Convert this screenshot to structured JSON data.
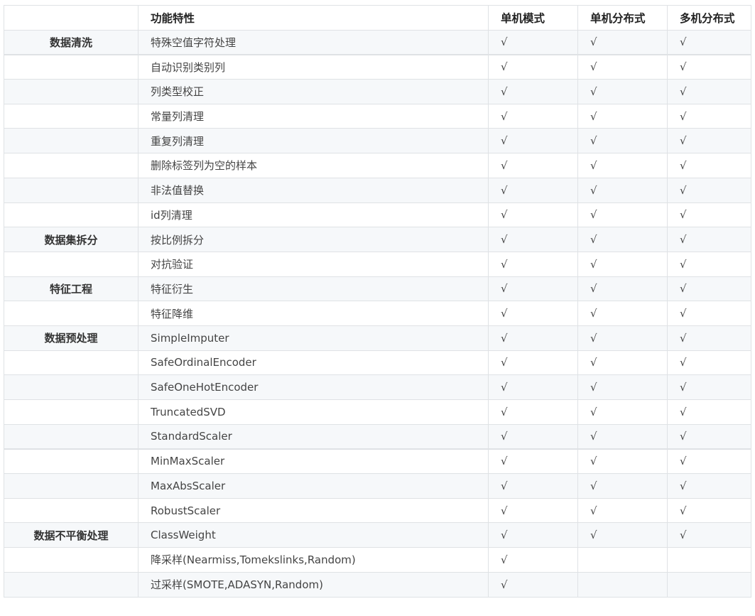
{
  "table": {
    "headers": [
      "",
      "功能特性",
      "单机模式",
      "单机分布式",
      "多机分布式"
    ],
    "check": "√",
    "rows": [
      {
        "category": "数据清洗",
        "feature": "特殊空值字符处理",
        "standalone": true,
        "standalone_distributed": true,
        "multi_distributed": true
      },
      {
        "category": "",
        "feature": "自动识别类别列",
        "standalone": true,
        "standalone_distributed": true,
        "multi_distributed": true
      },
      {
        "category": "",
        "feature": "列类型校正",
        "standalone": true,
        "standalone_distributed": true,
        "multi_distributed": true
      },
      {
        "category": "",
        "feature": "常量列清理",
        "standalone": true,
        "standalone_distributed": true,
        "multi_distributed": true
      },
      {
        "category": "",
        "feature": "重复列清理",
        "standalone": true,
        "standalone_distributed": true,
        "multi_distributed": true
      },
      {
        "category": "",
        "feature": "删除标签列为空的样本",
        "standalone": true,
        "standalone_distributed": true,
        "multi_distributed": true
      },
      {
        "category": "",
        "feature": "非法值替换",
        "standalone": true,
        "standalone_distributed": true,
        "multi_distributed": true
      },
      {
        "category": "",
        "feature": "id列清理",
        "standalone": true,
        "standalone_distributed": true,
        "multi_distributed": true
      },
      {
        "category": "数据集拆分",
        "feature": "按比例拆分",
        "standalone": true,
        "standalone_distributed": true,
        "multi_distributed": true
      },
      {
        "category": "",
        "feature": "对抗验证",
        "standalone": true,
        "standalone_distributed": true,
        "multi_distributed": true
      },
      {
        "category": "特征工程",
        "feature": "特征衍生",
        "standalone": true,
        "standalone_distributed": true,
        "multi_distributed": true
      },
      {
        "category": "",
        "feature": "特征降维",
        "standalone": true,
        "standalone_distributed": true,
        "multi_distributed": true
      },
      {
        "category": "数据预处理",
        "feature": "SimpleImputer",
        "standalone": true,
        "standalone_distributed": true,
        "multi_distributed": true
      },
      {
        "category": "",
        "feature": "SafeOrdinalEncoder",
        "standalone": true,
        "standalone_distributed": true,
        "multi_distributed": true
      },
      {
        "category": "",
        "feature": "SafeOneHotEncoder",
        "standalone": true,
        "standalone_distributed": true,
        "multi_distributed": true
      },
      {
        "category": "",
        "feature": "TruncatedSVD",
        "standalone": true,
        "standalone_distributed": true,
        "multi_distributed": true
      },
      {
        "category": "",
        "feature": "StandardScaler",
        "standalone": true,
        "standalone_distributed": true,
        "multi_distributed": true
      },
      {
        "category": "",
        "feature": "MinMaxScaler",
        "standalone": true,
        "standalone_distributed": true,
        "multi_distributed": true
      },
      {
        "category": "",
        "feature": "MaxAbsScaler",
        "standalone": true,
        "standalone_distributed": true,
        "multi_distributed": true
      },
      {
        "category": "",
        "feature": "RobustScaler",
        "standalone": true,
        "standalone_distributed": true,
        "multi_distributed": true
      },
      {
        "category": "数据不平衡处理",
        "feature": "ClassWeight",
        "standalone": true,
        "standalone_distributed": true,
        "multi_distributed": true
      },
      {
        "category": "",
        "feature": "降采样(Nearmiss,Tomekslinks,Random)",
        "standalone": true,
        "standalone_distributed": false,
        "multi_distributed": false
      },
      {
        "category": "",
        "feature": "过采样(SMOTE,ADASYN,Random)",
        "standalone": true,
        "standalone_distributed": false,
        "multi_distributed": false
      }
    ]
  }
}
